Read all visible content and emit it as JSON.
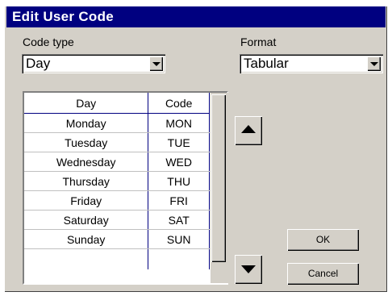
{
  "window": {
    "title": "Edit User Code"
  },
  "code_type": {
    "label": "Code type",
    "value": "Day"
  },
  "format": {
    "label": "Format",
    "value": "Tabular"
  },
  "grid": {
    "headers": [
      "Day",
      "Code"
    ],
    "rows": [
      [
        "Monday",
        "MON"
      ],
      [
        "Tuesday",
        "TUE"
      ],
      [
        "Wednesday",
        "WED"
      ],
      [
        "Thursday",
        "THU"
      ],
      [
        "Friday",
        "FRI"
      ],
      [
        "Saturday",
        "SAT"
      ],
      [
        "Sunday",
        "SUN"
      ]
    ]
  },
  "buttons": {
    "ok": "OK",
    "cancel": "Cancel"
  },
  "icons": {
    "up": "up-arrow-icon",
    "down": "down-arrow-icon",
    "dropdown": "chevron-down-icon"
  },
  "colors": {
    "titlebar": "#000080",
    "dialog": "#d4d0c8",
    "grid_border": "#000080"
  }
}
